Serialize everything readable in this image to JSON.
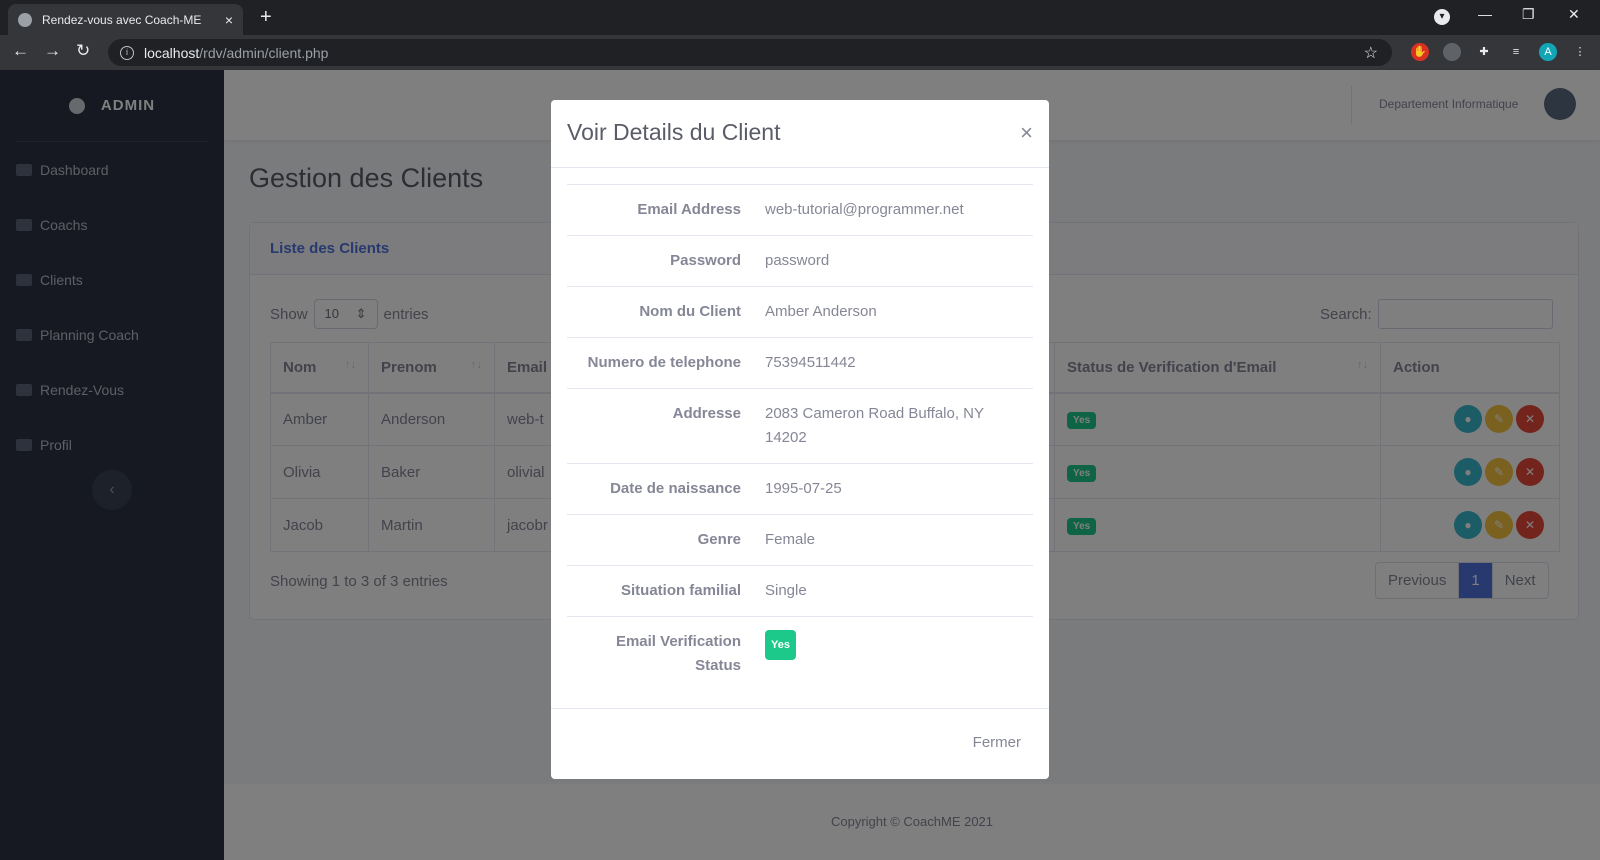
{
  "browser": {
    "tab_title": "Rendez-vous avec Coach-ME",
    "tab_close": "×",
    "new_tab": "+",
    "url_host": "localhost",
    "url_path": "/rdv/admin/client.php",
    "profile_initial": "A"
  },
  "sidebar": {
    "brand": "ADMIN",
    "items": [
      {
        "label": "Dashboard"
      },
      {
        "label": "Coachs"
      },
      {
        "label": "Clients"
      },
      {
        "label": "Planning Coach"
      },
      {
        "label": "Rendez-Vous"
      },
      {
        "label": "Profil"
      }
    ],
    "toggle_icon": "‹"
  },
  "topbar": {
    "user_name": "Departement Informatique"
  },
  "page": {
    "title": "Gestion des Clients",
    "card_title": "Liste des Clients",
    "show_label": "Show",
    "entries_value": "10",
    "entries_label": "entries",
    "search_label": "Search:",
    "columns": [
      "Nom",
      "Prenom",
      "Email",
      "Status de Verification d'Email",
      "Action"
    ],
    "rows": [
      {
        "nom": "Amber",
        "prenom": "Anderson",
        "email": "web-t",
        "status": "Yes"
      },
      {
        "nom": "Olivia",
        "prenom": "Baker",
        "email": "olivial",
        "status": "Yes"
      },
      {
        "nom": "Jacob",
        "prenom": "Martin",
        "email": "jacobr",
        "status": "Yes"
      }
    ],
    "showing": "Showing 1 to 3 of 3 entries",
    "pager": {
      "previous": "Previous",
      "current": "1",
      "next": "Next"
    },
    "footer": "Copyright © CoachME 2021"
  },
  "modal": {
    "title": "Voir Details du Client",
    "close": "×",
    "details": [
      {
        "label": "Email Address",
        "value": "web-tutorial@programmer.net"
      },
      {
        "label": "Password",
        "value": "password"
      },
      {
        "label": "Nom du Client",
        "value": "Amber Anderson"
      },
      {
        "label": "Numero de telephone",
        "value": "75394511442"
      },
      {
        "label": "Addresse",
        "value": "2083 Cameron Road Buffalo, NY 14202"
      },
      {
        "label": "Date de naissance",
        "value": "1995-07-25"
      },
      {
        "label": "Genre",
        "value": "Female"
      },
      {
        "label": "Situation familial",
        "value": "Single"
      },
      {
        "label": "Email Verification Status",
        "value": "Yes"
      }
    ],
    "footer_button": "Fermer"
  },
  "icons": {
    "view": "eye-icon",
    "edit": "edit-icon",
    "delete": "close-icon"
  },
  "colors": {
    "sidebar_bg": "#2c3344",
    "primary": "#4e73df",
    "success": "#1cc88a",
    "info": "#36b9cc",
    "warning": "#f6c23e",
    "danger": "#e74a3b"
  }
}
